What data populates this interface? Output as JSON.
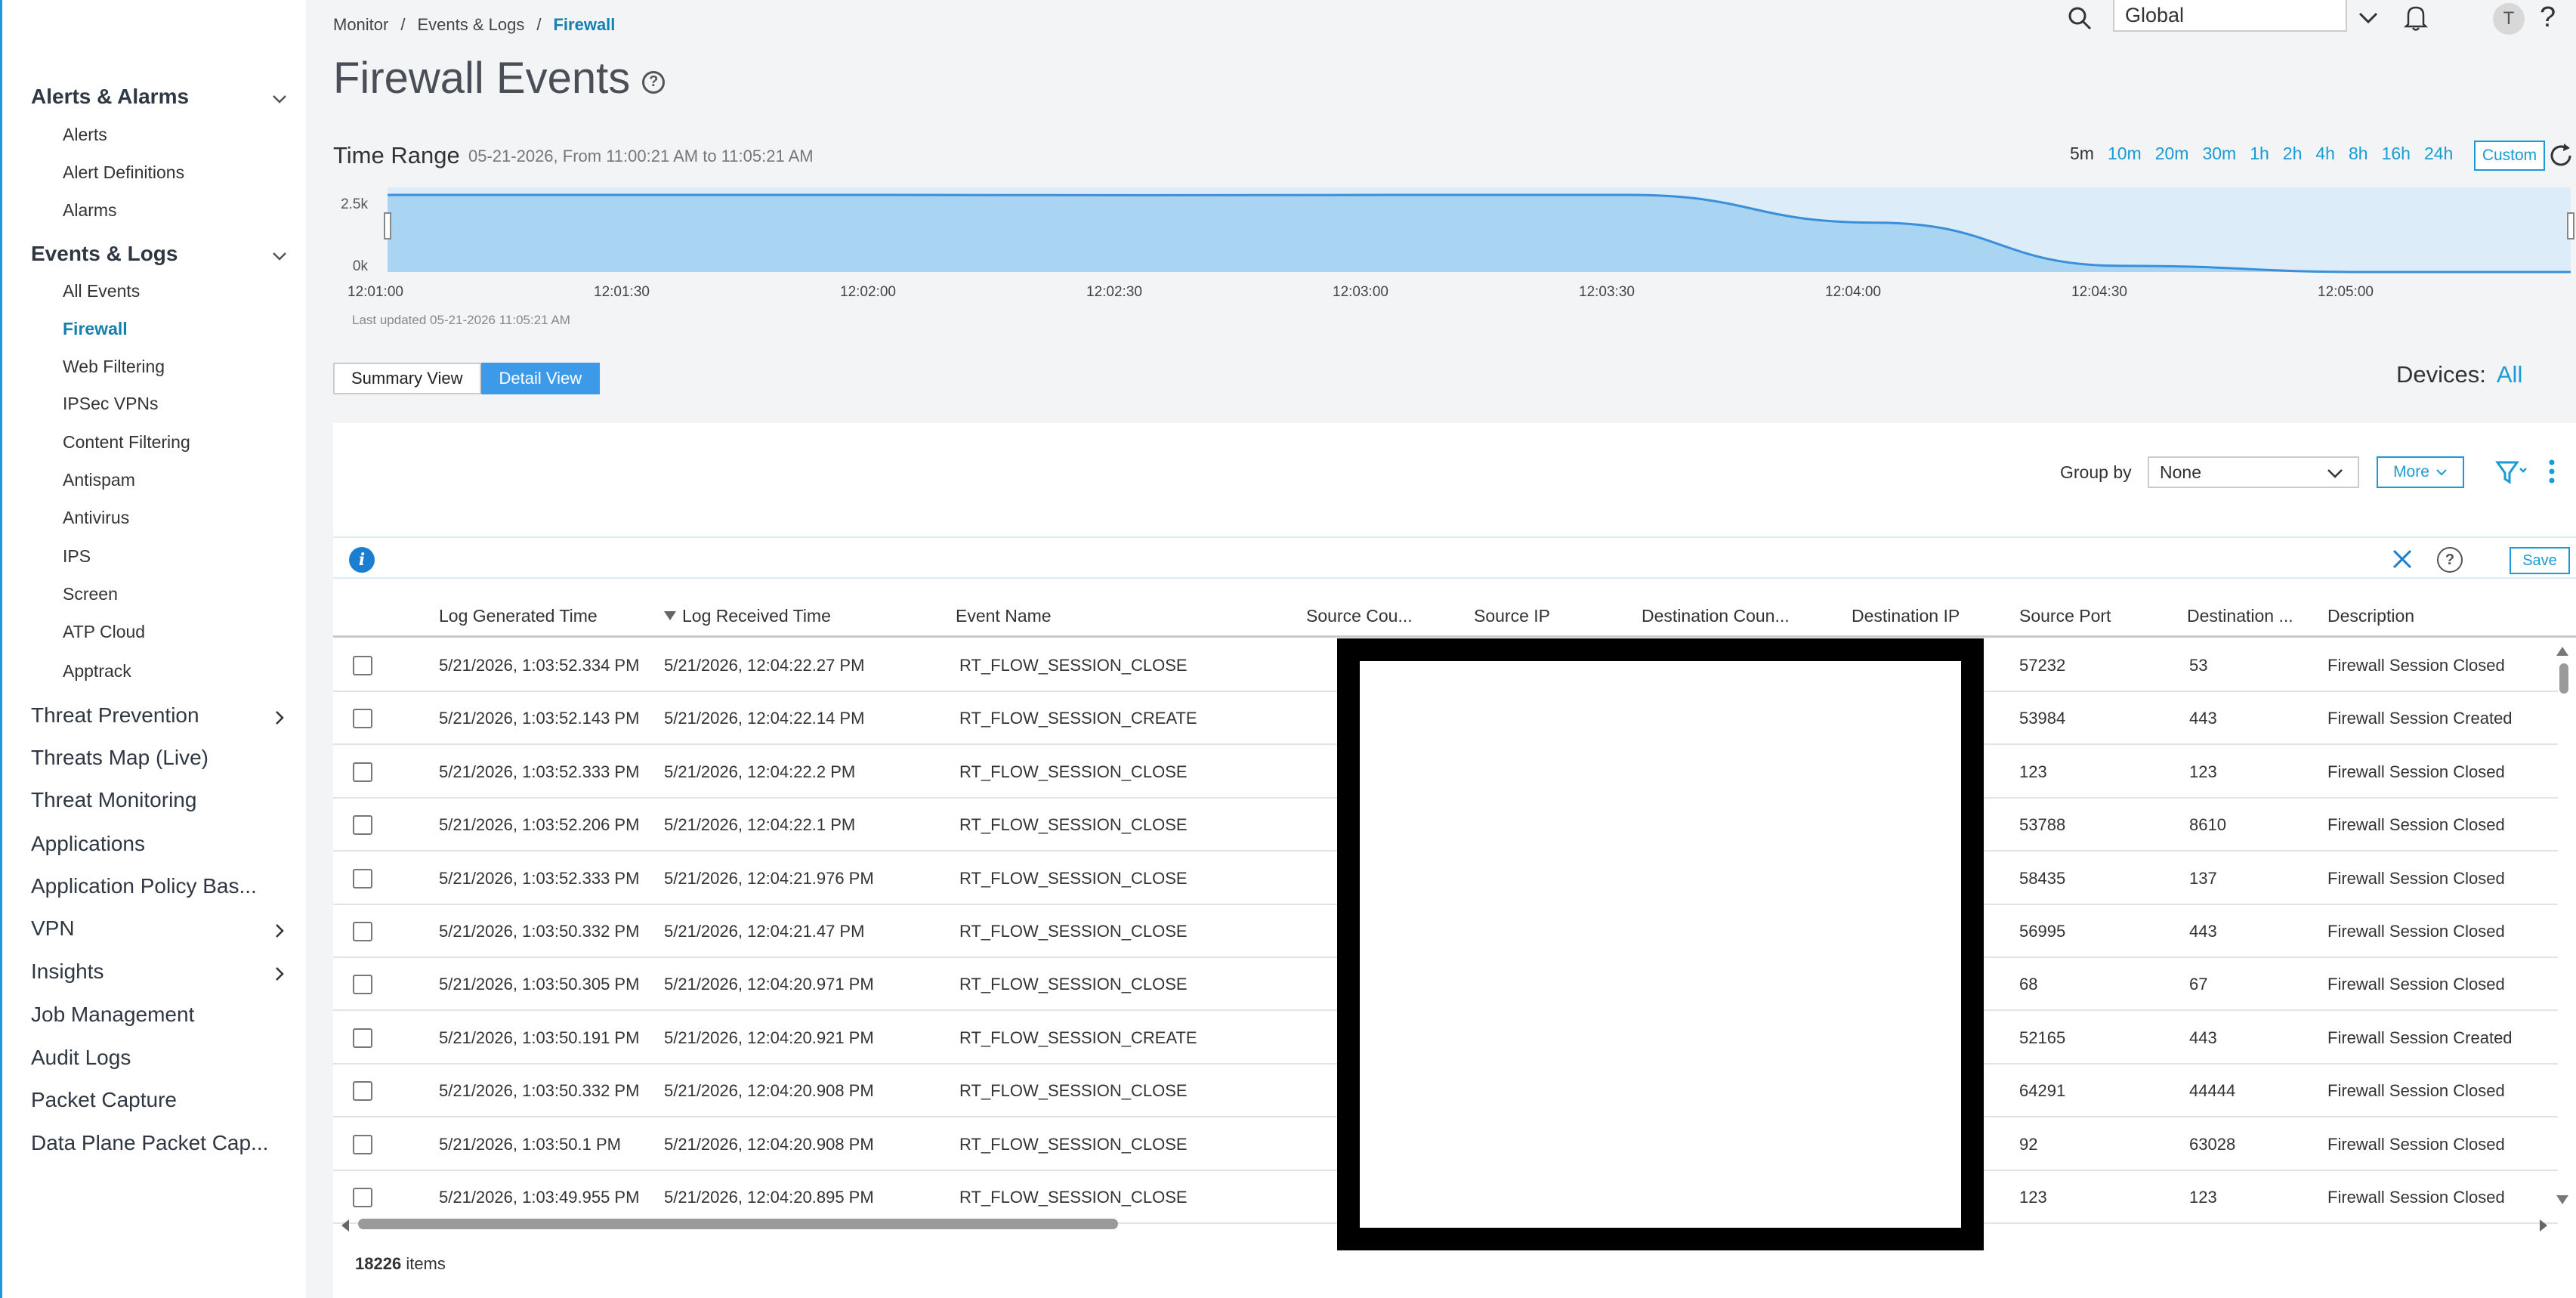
{
  "sidebar": {
    "groups": [
      {
        "label": "Alerts & Alarms",
        "items": [
          "Alerts",
          "Alert Definitions",
          "Alarms"
        ]
      },
      {
        "label": "Events & Logs",
        "items": [
          "All Events",
          "Firewall",
          "Web Filtering",
          "IPSec VPNs",
          "Content Filtering",
          "Antispam",
          "Antivirus",
          "IPS",
          "Screen",
          "ATP Cloud",
          "Apptrack"
        ]
      }
    ],
    "active_item": "Firewall",
    "top_items": [
      "Threat Prevention",
      "Threats Map (Live)",
      "Threat Monitoring",
      "Applications",
      "Application Policy Bas...",
      "VPN",
      "Insights",
      "Job Management",
      "Audit Logs",
      "Packet Capture",
      "Data Plane Packet Cap..."
    ]
  },
  "breadcrumb": {
    "items": [
      "Monitor",
      "Events & Logs",
      "Firewall"
    ],
    "sep": "/"
  },
  "page": {
    "title": "Firewall Events",
    "help": "?"
  },
  "topbar": {
    "global_value": "Global",
    "avatar": "T",
    "help": "?"
  },
  "time_range": {
    "label": "Time Range",
    "value": "05-21-2026, From 11:00:21 AM to 11:05:21 AM",
    "buttons": [
      "5m",
      "10m",
      "20m",
      "30m",
      "1h",
      "2h",
      "4h",
      "8h",
      "16h",
      "24h"
    ],
    "active": "5m",
    "custom_label": "Custom"
  },
  "chart_data": {
    "type": "area",
    "x": [
      "12:01:00",
      "12:01:30",
      "12:02:00",
      "12:02:30",
      "12:03:00",
      "12:03:30",
      "12:04:00",
      "12:04:30",
      "12:05:00"
    ],
    "values": [
      2.5,
      2.5,
      2.5,
      2.49,
      2.5,
      2.5,
      1.6,
      0.2,
      0.0
    ],
    "y_ticks": [
      "2.5k",
      "0k"
    ],
    "ylim": [
      0,
      2.5
    ],
    "color": "#a9d5f2",
    "line_color": "#3a8fd8",
    "last_updated": "Last updated 05-21-2026 11:05:21 AM"
  },
  "views": {
    "summary": "Summary View",
    "detail": "Detail View",
    "active": "Detail View"
  },
  "devices": {
    "label": "Devices:",
    "value": "All"
  },
  "toolbar": {
    "group_by_label": "Group by",
    "group_by_value": "None",
    "more_label": "More"
  },
  "info_bar": {
    "save_label": "Save",
    "help": "?"
  },
  "table": {
    "columns": [
      "Log Generated Time",
      "Log Received Time",
      "Event Name",
      "Source Cou...",
      "Source IP",
      "Destination Coun...",
      "Destination IP",
      "Source Port",
      "Destination ...",
      "Description"
    ],
    "rows": [
      [
        "5/21/2026, 1:03:52.334 PM",
        "5/21/2026, 12:04:22.27 PM",
        "RT_FLOW_SESSION_CLOSE",
        "57232",
        "53",
        "Firewall Session Closed"
      ],
      [
        "5/21/2026, 1:03:52.143 PM",
        "5/21/2026, 12:04:22.14 PM",
        "RT_FLOW_SESSION_CREATE",
        "53984",
        "443",
        "Firewall Session Created"
      ],
      [
        "5/21/2026, 1:03:52.333 PM",
        "5/21/2026, 12:04:22.2 PM",
        "RT_FLOW_SESSION_CLOSE",
        "123",
        "123",
        "Firewall Session Closed"
      ],
      [
        "5/21/2026, 1:03:52.206 PM",
        "5/21/2026, 12:04:22.1 PM",
        "RT_FLOW_SESSION_CLOSE",
        "53788",
        "8610",
        "Firewall Session Closed"
      ],
      [
        "5/21/2026, 1:03:52.333 PM",
        "5/21/2026, 12:04:21.976 PM",
        "RT_FLOW_SESSION_CLOSE",
        "58435",
        "137",
        "Firewall Session Closed"
      ],
      [
        "5/21/2026, 1:03:50.332 PM",
        "5/21/2026, 12:04:21.47 PM",
        "RT_FLOW_SESSION_CLOSE",
        "56995",
        "443",
        "Firewall Session Closed"
      ],
      [
        "5/21/2026, 1:03:50.305 PM",
        "5/21/2026, 12:04:20.971 PM",
        "RT_FLOW_SESSION_CLOSE",
        "68",
        "67",
        "Firewall Session Closed"
      ],
      [
        "5/21/2026, 1:03:50.191 PM",
        "5/21/2026, 12:04:20.921 PM",
        "RT_FLOW_SESSION_CREATE",
        "52165",
        "443",
        "Firewall Session Created"
      ],
      [
        "5/21/2026, 1:03:50.332 PM",
        "5/21/2026, 12:04:20.908 PM",
        "RT_FLOW_SESSION_CLOSE",
        "64291",
        "44444",
        "Firewall Session Closed"
      ],
      [
        "5/21/2026, 1:03:50.1 PM",
        "5/21/2026, 12:04:20.908 PM",
        "RT_FLOW_SESSION_CLOSE",
        "92",
        "63028",
        "Firewall Session Closed"
      ],
      [
        "5/21/2026, 1:03:49.955 PM",
        "5/21/2026, 12:04:20.895 PM",
        "RT_FLOW_SESSION_CLOSE",
        "123",
        "123",
        "Firewall Session Closed"
      ]
    ],
    "total_count": "18226",
    "count_suffix": "items"
  }
}
